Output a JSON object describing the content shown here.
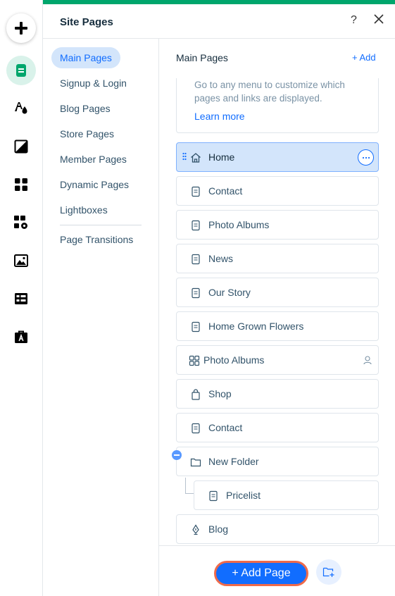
{
  "panel": {
    "title": "Site Pages",
    "help_label": "?"
  },
  "rail": {
    "items": [
      "add-elements",
      "pages-menus",
      "site-design",
      "background",
      "app-market",
      "business-tools",
      "media",
      "cms",
      "portfolio"
    ]
  },
  "categories": [
    {
      "label": "Main Pages",
      "active": true
    },
    {
      "label": "Signup & Login",
      "active": false
    },
    {
      "label": "Blog Pages",
      "active": false
    },
    {
      "label": "Store Pages",
      "active": false
    },
    {
      "label": "Member Pages",
      "active": false
    },
    {
      "label": "Dynamic Pages",
      "active": false
    },
    {
      "label": "Lightboxes",
      "active": false
    },
    {
      "label": "Page Transitions",
      "active": false
    }
  ],
  "main": {
    "section_title": "Main Pages",
    "add_label": "+ Add",
    "info_text": "Go to any menu to customize which pages and links are displayed.",
    "learn_more": "Learn more",
    "pages": [
      {
        "label": "Home",
        "icon": "home-icon",
        "selected": true
      },
      {
        "label": "Contact",
        "icon": "page-icon"
      },
      {
        "label": "Photo Albums",
        "icon": "page-icon"
      },
      {
        "label": "News",
        "icon": "page-icon"
      },
      {
        "label": "Our Story",
        "icon": "page-icon"
      },
      {
        "label": "Home Grown Flowers",
        "icon": "page-icon"
      },
      {
        "label": "Photo Albums",
        "icon": "app-icon",
        "members_only": true
      },
      {
        "label": "Shop",
        "icon": "shopping-bag-icon"
      },
      {
        "label": "Contact",
        "icon": "page-icon"
      },
      {
        "label": "New Folder",
        "icon": "folder-icon",
        "folder": true
      },
      {
        "label": "Pricelist",
        "icon": "page-icon",
        "child": true
      },
      {
        "label": "Blog",
        "icon": "pen-icon"
      }
    ]
  },
  "footer": {
    "add_page_label": "+ Add Page"
  },
  "colors": {
    "accent": "#00a66c",
    "primary": "#116dff",
    "selected_bg": "#d3e5fb",
    "highlight_outline": "#ef6a4a"
  }
}
